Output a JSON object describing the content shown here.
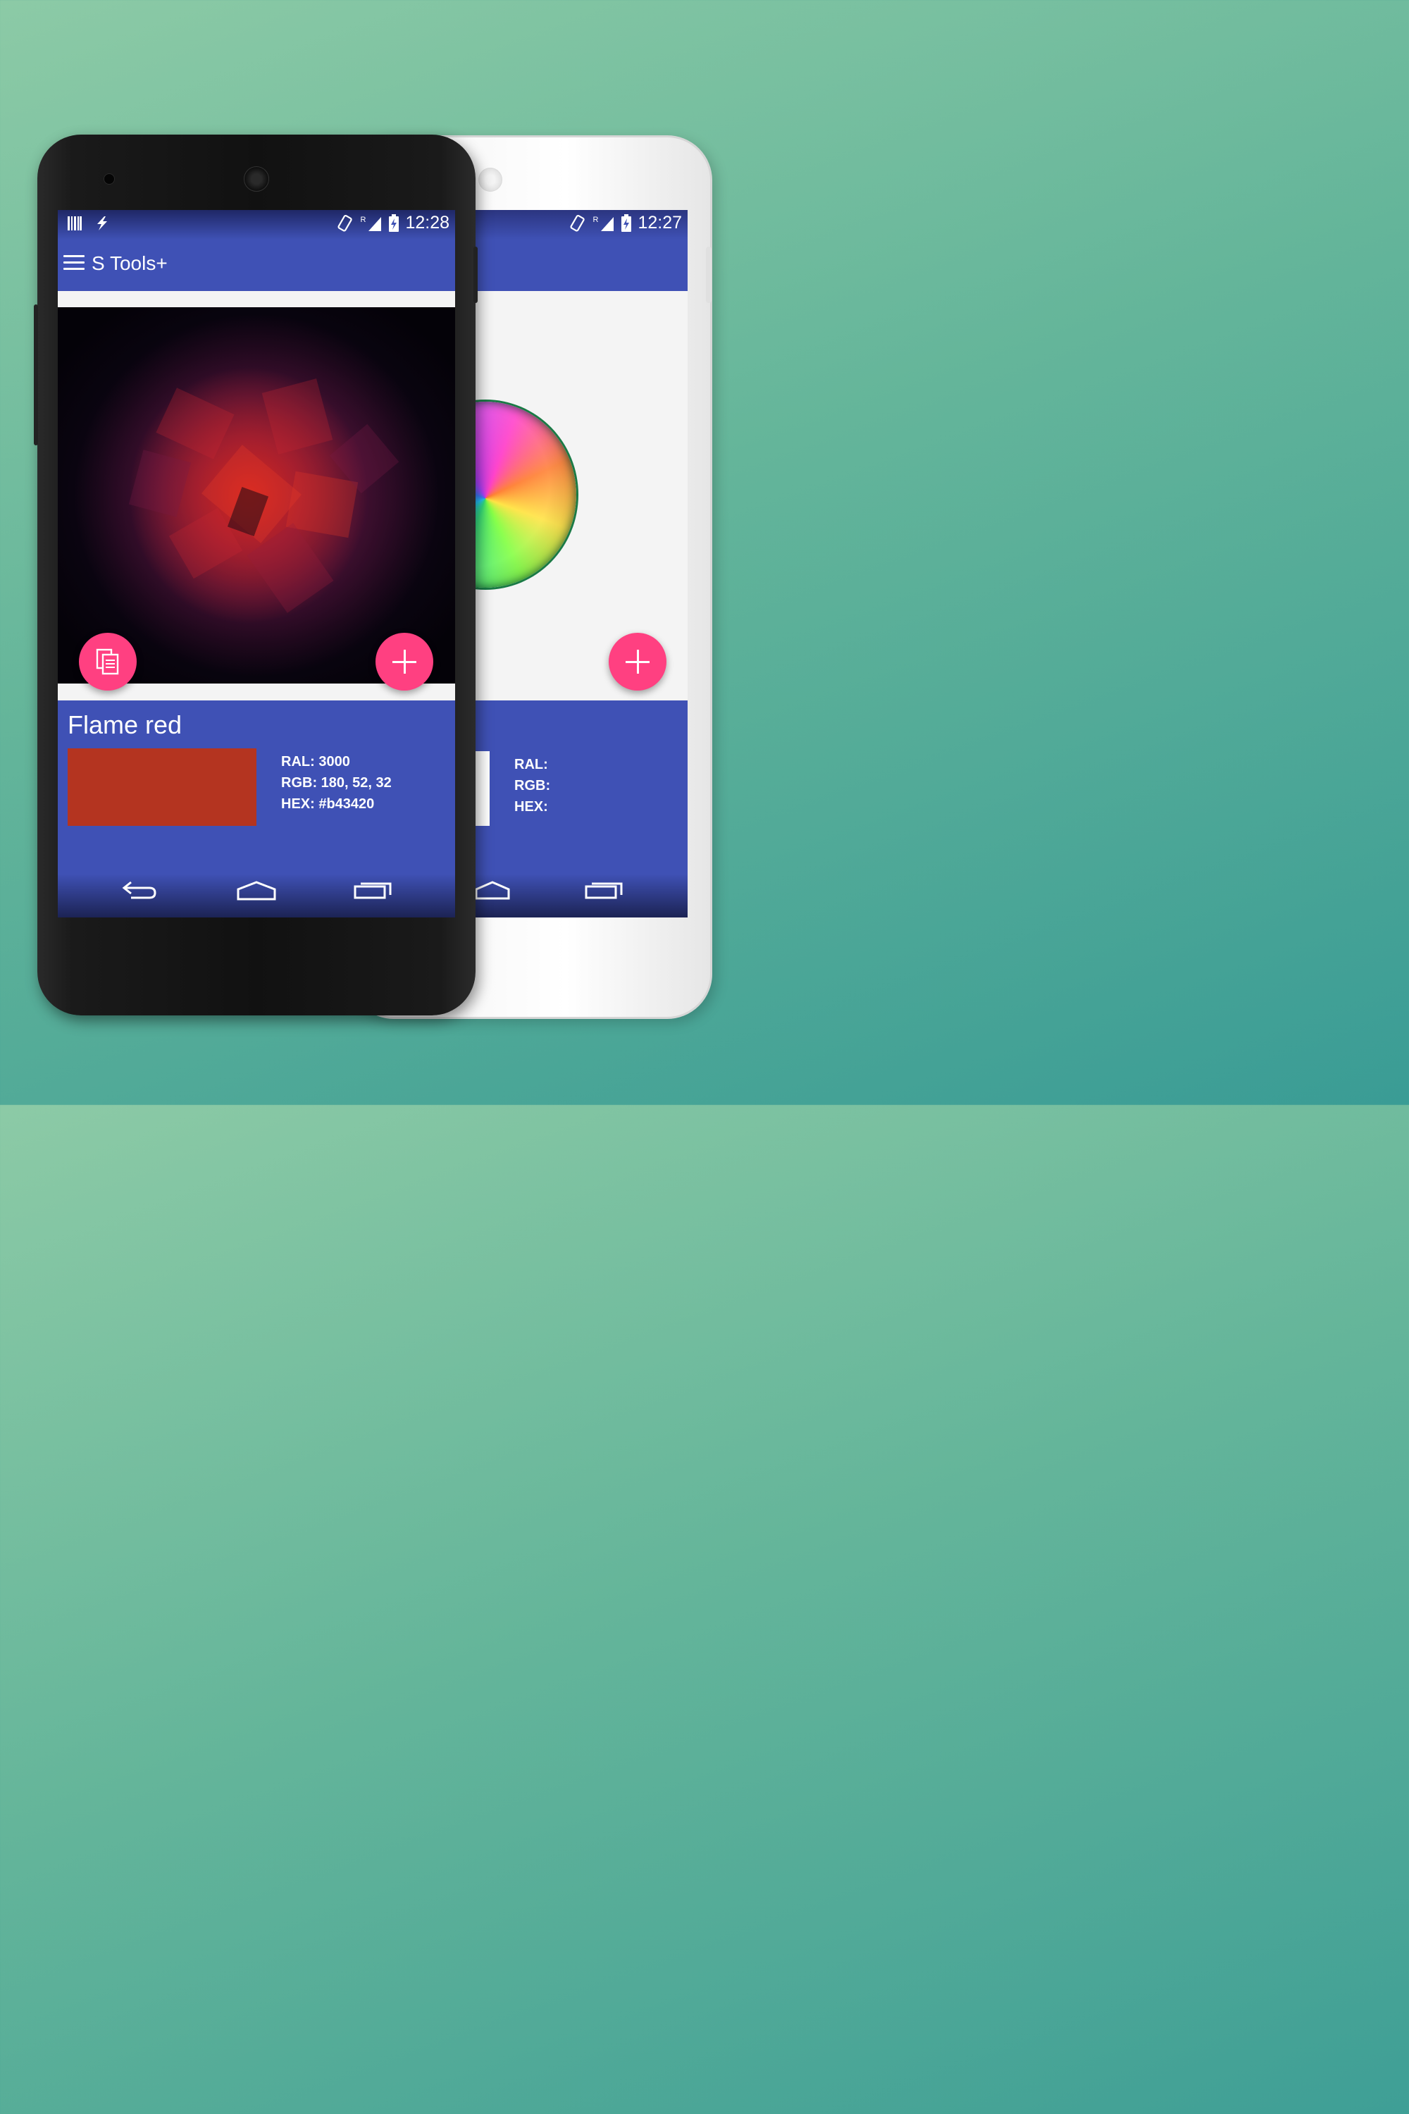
{
  "colors": {
    "background": "#6fbc9f",
    "primary": "#3f51b5",
    "accent": "#ff4081",
    "swatch": "#b43420",
    "white_swatch": "#ffffff"
  },
  "front_phone": {
    "status_bar": {
      "time": "12:28",
      "roaming_indicator": "R",
      "icons_left": [
        "barcode-icon",
        "flash-icon"
      ],
      "icons_right": [
        "screen-rotation-icon",
        "signal-icon",
        "battery-charging-icon"
      ]
    },
    "toolbar": {
      "menu_icon": "hamburger-menu-icon",
      "title": "S Tools+"
    },
    "content": {
      "image": "flame-red-abstract-image",
      "copy_fab_icon": "copy-icon",
      "add_fab_icon": "plus-icon"
    },
    "color_card": {
      "name": "Flame red",
      "ral": "RAL: 3000",
      "rgb": "RGB: 180, 52, 32",
      "hex": "HEX: #b43420"
    },
    "nav_bar": {
      "back_icon": "back-icon",
      "home_icon": "home-icon",
      "recents_icon": "recents-icon"
    }
  },
  "back_phone": {
    "status_bar": {
      "time": "12:27",
      "roaming_indicator": "R"
    },
    "content": {
      "image": "rainbow-sphere-image",
      "add_fab_icon": "plus-icon"
    },
    "color_card": {
      "ral": "RAL:",
      "rgb": "RGB:",
      "hex": "HEX:"
    }
  }
}
